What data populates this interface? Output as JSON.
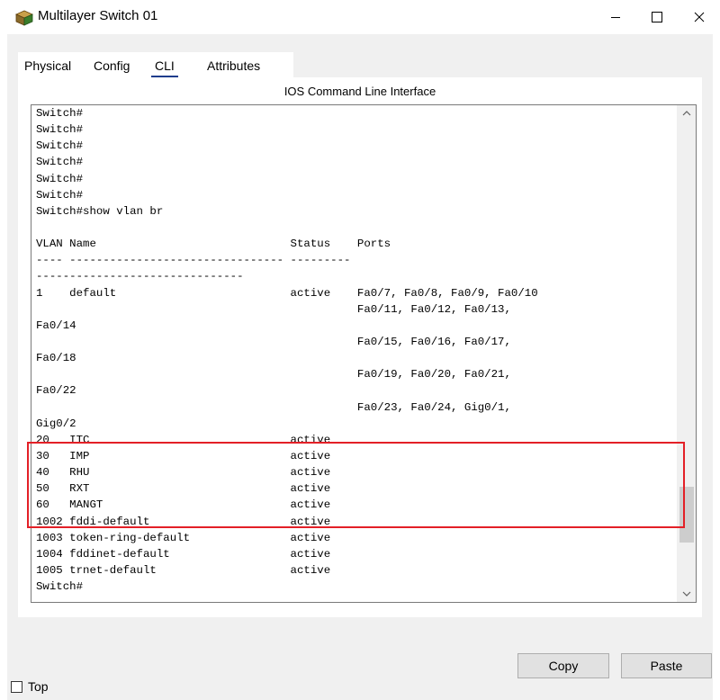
{
  "window": {
    "title": "Multilayer Switch 01",
    "icon": "switch-app-icon",
    "controls": {
      "minimize": "minimize-icon",
      "maximize": "maximize-icon",
      "close": "close-icon"
    }
  },
  "tabs": [
    {
      "label": "Physical",
      "active": false
    },
    {
      "label": "Config",
      "active": false
    },
    {
      "label": "CLI",
      "active": true
    },
    {
      "label": "Attributes",
      "active": false
    }
  ],
  "cli": {
    "header": "IOS Command Line Interface",
    "lines": [
      "Switch#",
      "Switch#",
      "Switch#",
      "Switch#",
      "Switch#",
      "Switch#",
      "Switch#show vlan br",
      "",
      "VLAN Name                             Status    Ports",
      "---- -------------------------------- ---------",
      "-------------------------------",
      "1    default                          active    Fa0/7, Fa0/8, Fa0/9, Fa0/10",
      "                                                Fa0/11, Fa0/12, Fa0/13,",
      "Fa0/14",
      "                                                Fa0/15, Fa0/16, Fa0/17,",
      "Fa0/18",
      "                                                Fa0/19, Fa0/20, Fa0/21,",
      "Fa0/22",
      "                                                Fa0/23, Fa0/24, Gig0/1,",
      "Gig0/2",
      "20   ITC                              active",
      "30   IMP                              active",
      "40   RHU                              active",
      "50   RXT                              active",
      "60   MANGT                            active",
      "1002 fddi-default                     active",
      "1003 token-ring-default               active",
      "1004 fddinet-default                  active",
      "1005 trnet-default                    active",
      "Switch#"
    ],
    "highlight_color": "#e32027"
  },
  "buttons": {
    "copy": "Copy",
    "paste": "Paste"
  },
  "footer": {
    "top_label": "Top",
    "top_checked": false
  },
  "colors": {
    "tab_underline": "#1f3d8c",
    "client_bg": "#f0f0f0"
  }
}
